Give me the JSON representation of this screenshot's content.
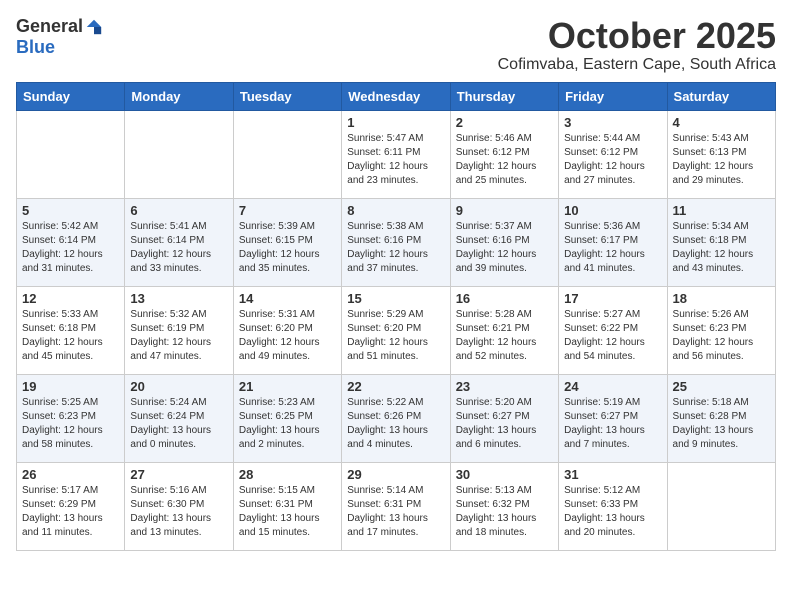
{
  "logo": {
    "general": "General",
    "blue": "Blue"
  },
  "title": "October 2025",
  "location": "Cofimvaba, Eastern Cape, South Africa",
  "days_of_week": [
    "Sunday",
    "Monday",
    "Tuesday",
    "Wednesday",
    "Thursday",
    "Friday",
    "Saturday"
  ],
  "weeks": [
    [
      {
        "day": "",
        "info": ""
      },
      {
        "day": "",
        "info": ""
      },
      {
        "day": "",
        "info": ""
      },
      {
        "day": "1",
        "info": "Sunrise: 5:47 AM\nSunset: 6:11 PM\nDaylight: 12 hours\nand 23 minutes."
      },
      {
        "day": "2",
        "info": "Sunrise: 5:46 AM\nSunset: 6:12 PM\nDaylight: 12 hours\nand 25 minutes."
      },
      {
        "day": "3",
        "info": "Sunrise: 5:44 AM\nSunset: 6:12 PM\nDaylight: 12 hours\nand 27 minutes."
      },
      {
        "day": "4",
        "info": "Sunrise: 5:43 AM\nSunset: 6:13 PM\nDaylight: 12 hours\nand 29 minutes."
      }
    ],
    [
      {
        "day": "5",
        "info": "Sunrise: 5:42 AM\nSunset: 6:14 PM\nDaylight: 12 hours\nand 31 minutes."
      },
      {
        "day": "6",
        "info": "Sunrise: 5:41 AM\nSunset: 6:14 PM\nDaylight: 12 hours\nand 33 minutes."
      },
      {
        "day": "7",
        "info": "Sunrise: 5:39 AM\nSunset: 6:15 PM\nDaylight: 12 hours\nand 35 minutes."
      },
      {
        "day": "8",
        "info": "Sunrise: 5:38 AM\nSunset: 6:16 PM\nDaylight: 12 hours\nand 37 minutes."
      },
      {
        "day": "9",
        "info": "Sunrise: 5:37 AM\nSunset: 6:16 PM\nDaylight: 12 hours\nand 39 minutes."
      },
      {
        "day": "10",
        "info": "Sunrise: 5:36 AM\nSunset: 6:17 PM\nDaylight: 12 hours\nand 41 minutes."
      },
      {
        "day": "11",
        "info": "Sunrise: 5:34 AM\nSunset: 6:18 PM\nDaylight: 12 hours\nand 43 minutes."
      }
    ],
    [
      {
        "day": "12",
        "info": "Sunrise: 5:33 AM\nSunset: 6:18 PM\nDaylight: 12 hours\nand 45 minutes."
      },
      {
        "day": "13",
        "info": "Sunrise: 5:32 AM\nSunset: 6:19 PM\nDaylight: 12 hours\nand 47 minutes."
      },
      {
        "day": "14",
        "info": "Sunrise: 5:31 AM\nSunset: 6:20 PM\nDaylight: 12 hours\nand 49 minutes."
      },
      {
        "day": "15",
        "info": "Sunrise: 5:29 AM\nSunset: 6:20 PM\nDaylight: 12 hours\nand 51 minutes."
      },
      {
        "day": "16",
        "info": "Sunrise: 5:28 AM\nSunset: 6:21 PM\nDaylight: 12 hours\nand 52 minutes."
      },
      {
        "day": "17",
        "info": "Sunrise: 5:27 AM\nSunset: 6:22 PM\nDaylight: 12 hours\nand 54 minutes."
      },
      {
        "day": "18",
        "info": "Sunrise: 5:26 AM\nSunset: 6:23 PM\nDaylight: 12 hours\nand 56 minutes."
      }
    ],
    [
      {
        "day": "19",
        "info": "Sunrise: 5:25 AM\nSunset: 6:23 PM\nDaylight: 12 hours\nand 58 minutes."
      },
      {
        "day": "20",
        "info": "Sunrise: 5:24 AM\nSunset: 6:24 PM\nDaylight: 13 hours\nand 0 minutes."
      },
      {
        "day": "21",
        "info": "Sunrise: 5:23 AM\nSunset: 6:25 PM\nDaylight: 13 hours\nand 2 minutes."
      },
      {
        "day": "22",
        "info": "Sunrise: 5:22 AM\nSunset: 6:26 PM\nDaylight: 13 hours\nand 4 minutes."
      },
      {
        "day": "23",
        "info": "Sunrise: 5:20 AM\nSunset: 6:27 PM\nDaylight: 13 hours\nand 6 minutes."
      },
      {
        "day": "24",
        "info": "Sunrise: 5:19 AM\nSunset: 6:27 PM\nDaylight: 13 hours\nand 7 minutes."
      },
      {
        "day": "25",
        "info": "Sunrise: 5:18 AM\nSunset: 6:28 PM\nDaylight: 13 hours\nand 9 minutes."
      }
    ],
    [
      {
        "day": "26",
        "info": "Sunrise: 5:17 AM\nSunset: 6:29 PM\nDaylight: 13 hours\nand 11 minutes."
      },
      {
        "day": "27",
        "info": "Sunrise: 5:16 AM\nSunset: 6:30 PM\nDaylight: 13 hours\nand 13 minutes."
      },
      {
        "day": "28",
        "info": "Sunrise: 5:15 AM\nSunset: 6:31 PM\nDaylight: 13 hours\nand 15 minutes."
      },
      {
        "day": "29",
        "info": "Sunrise: 5:14 AM\nSunset: 6:31 PM\nDaylight: 13 hours\nand 17 minutes."
      },
      {
        "day": "30",
        "info": "Sunrise: 5:13 AM\nSunset: 6:32 PM\nDaylight: 13 hours\nand 18 minutes."
      },
      {
        "day": "31",
        "info": "Sunrise: 5:12 AM\nSunset: 6:33 PM\nDaylight: 13 hours\nand 20 minutes."
      },
      {
        "day": "",
        "info": ""
      }
    ]
  ]
}
